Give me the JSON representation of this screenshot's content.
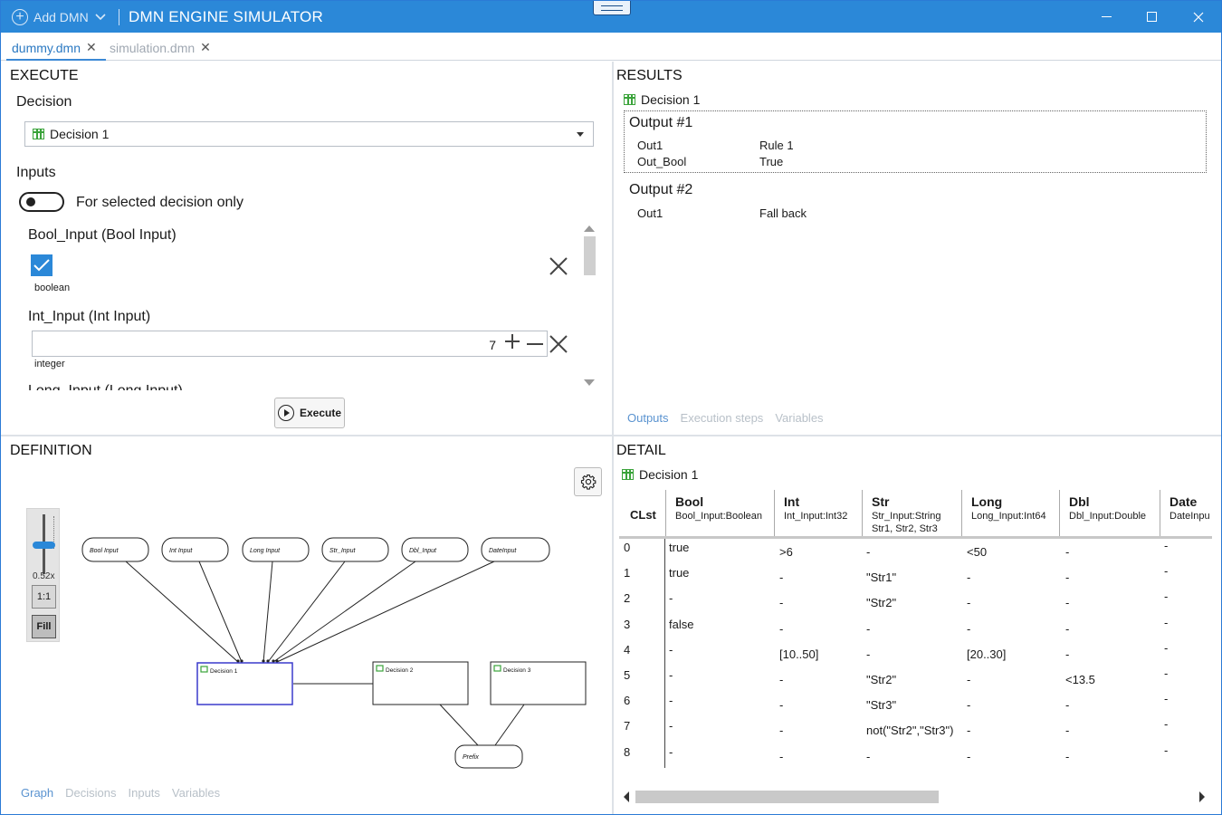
{
  "titlebar": {
    "add_dmn": "Add DMN",
    "app_title": "DMN ENGINE SIMULATOR"
  },
  "tabs": [
    {
      "label": "dummy.dmn",
      "active": true
    },
    {
      "label": "simulation.dmn",
      "active": false
    }
  ],
  "execute": {
    "title": "EXECUTE",
    "decision_label": "Decision",
    "selected_decision": "Decision 1",
    "inputs_label": "Inputs",
    "toggle_label": "For selected decision only",
    "toggle_on": false,
    "inputs": [
      {
        "title": "Bool_Input (Bool Input)",
        "type": "boolean",
        "checked": true
      },
      {
        "title": "Int_Input (Int Input)",
        "type": "integer",
        "value": "7"
      },
      {
        "title": "Long_Input (Long Input)"
      }
    ],
    "execute_button": "Execute"
  },
  "results": {
    "title": "RESULTS",
    "decision": "Decision 1",
    "outputs": [
      {
        "heading": "Output #1",
        "rows": [
          {
            "name": "Out1",
            "value": "Rule 1"
          },
          {
            "name": "Out_Bool",
            "value": "True"
          }
        ]
      },
      {
        "heading": "Output #2",
        "rows": [
          {
            "name": "Out1",
            "value": "Fall back"
          }
        ]
      }
    ],
    "tabs": [
      "Outputs",
      "Execution steps",
      "Variables"
    ],
    "active_tab": "Outputs"
  },
  "definition": {
    "title": "DEFINITION",
    "zoom_level": "0.52x",
    "zoom_1to1": "1:1",
    "zoom_fill": "Fill",
    "graph": {
      "inputs": [
        "Bool Input",
        "Int Input",
        "Long Input",
        "Str_Input",
        "Dbl_Input",
        "DateInput"
      ],
      "decisions": [
        "Decision 1",
        "Decision 2",
        "Decision 3"
      ],
      "knowledge": [
        "Prefix"
      ],
      "selected": "Decision 1"
    },
    "tabs": [
      "Graph",
      "Decisions",
      "Inputs",
      "Variables"
    ],
    "active_tab": "Graph"
  },
  "detail": {
    "title": "DETAIL",
    "decision": "Decision 1",
    "table": {
      "clst_header": "CLst",
      "columns": [
        {
          "name": "Bool",
          "sub1": "Bool_Input:Boolean",
          "sub2": ""
        },
        {
          "name": "Int",
          "sub1": "Int_Input:Int32",
          "sub2": ""
        },
        {
          "name": "Str",
          "sub1": "Str_Input:String",
          "sub2": "Str1, Str2, Str3"
        },
        {
          "name": "Long",
          "sub1": "Long_Input:Int64",
          "sub2": ""
        },
        {
          "name": "Dbl",
          "sub1": "Dbl_Input:Double",
          "sub2": ""
        },
        {
          "name": "Date",
          "sub1": "DateInpu",
          "sub2": ""
        }
      ],
      "rows": [
        {
          "idx": "0",
          "cells": [
            "true",
            ">6",
            "-",
            "<50",
            "-",
            "-"
          ]
        },
        {
          "idx": "1",
          "cells": [
            "true",
            "-",
            "\"Str1\"",
            "-",
            "-",
            "-"
          ]
        },
        {
          "idx": "2",
          "cells": [
            "-",
            "-",
            "\"Str2\"",
            "-",
            "-",
            "-"
          ]
        },
        {
          "idx": "3",
          "cells": [
            "false",
            "-",
            "-",
            "-",
            "-",
            "-"
          ]
        },
        {
          "idx": "4",
          "cells": [
            "-",
            "[10..50]",
            "-",
            "[20..30]",
            "-",
            "-"
          ]
        },
        {
          "idx": "5",
          "cells": [
            "-",
            "-",
            "\"Str2\"",
            "-",
            "<13.5",
            "-"
          ]
        },
        {
          "idx": "6",
          "cells": [
            "-",
            "-",
            "\"Str3\"",
            "-",
            "-",
            "-"
          ]
        },
        {
          "idx": "7",
          "cells": [
            "-",
            "-",
            "not(\"Str2\",\"Str3\")",
            "-",
            "-",
            "-"
          ]
        },
        {
          "idx": "8",
          "cells": [
            "-",
            "-",
            "-",
            "-",
            "-",
            "-"
          ]
        }
      ]
    }
  },
  "colors": {
    "accent": "#2b88d8",
    "titlebar": "#2b88d8",
    "active_tab_text": "#2b79c2",
    "inactive_text": "#b8c0c8",
    "decision_icon": "#3aa33a",
    "selected_node_border": "#3a3acc"
  }
}
